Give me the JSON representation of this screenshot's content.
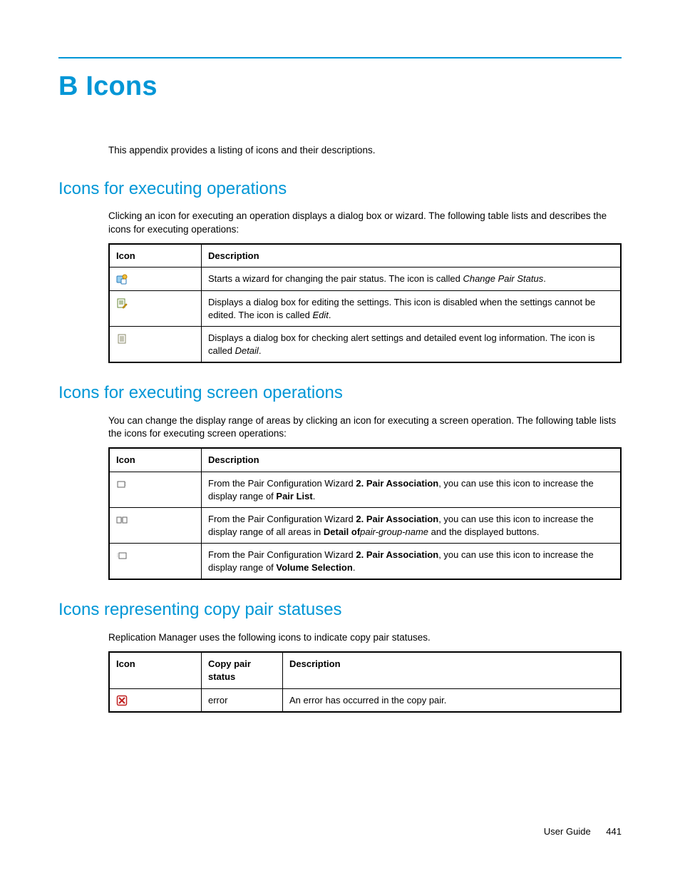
{
  "title": "B Icons",
  "intro": "This appendix provides a listing of icons and their descriptions.",
  "sec1": {
    "heading": "Icons for executing operations",
    "body": "Clicking an icon for executing an operation displays a dialog box or wizard. The following table lists and describes the icons for executing operations:",
    "head_icon": "Icon",
    "head_desc": "Description",
    "row1_desc_a": "Starts a wizard for changing the pair status. The icon is called ",
    "row1_desc_em": "Change Pair Status",
    "row1_desc_b": ".",
    "row2_desc_a": "Displays a dialog box for editing the settings. This icon is disabled when the settings cannot be edited. The icon is called ",
    "row2_desc_em": "Edit",
    "row2_desc_b": ".",
    "row3_desc_a": "Displays a dialog box for checking alert settings and detailed event log information. The icon is called ",
    "row3_desc_em": "Detail",
    "row3_desc_b": "."
  },
  "sec2": {
    "heading": "Icons for executing screen operations",
    "body": "You can change the display range of areas by clicking an icon for executing a screen operation. The following table lists the icons for executing screen operations:",
    "head_icon": "Icon",
    "head_desc": "Description",
    "r1a": "From the Pair Configuration Wizard ",
    "r1b": "2. Pair Association",
    "r1c": ", you can use this icon to increase the display range of ",
    "r1d": "Pair List",
    "r1e": ".",
    "r2a": "From the Pair Configuration Wizard ",
    "r2b": "2. Pair Association",
    "r2c": ", you can use this icon to increase the display range of all areas in ",
    "r2d": "Detail of",
    "r2e": "pair-group-name",
    "r2f": " and the displayed buttons.",
    "r3a": "From the Pair Configuration Wizard ",
    "r3b": "2. Pair Association",
    "r3c": ", you can use this icon to increase the display range of ",
    "r3d": "Volume Selection",
    "r3e": "."
  },
  "sec3": {
    "heading": "Icons representing copy pair statuses",
    "body": "Replication Manager uses the following icons to indicate copy pair statuses.",
    "head_icon": "Icon",
    "head_status": "Copy pair status",
    "head_desc": "Description",
    "status1": "error",
    "desc1": "An error has occurred in the copy pair."
  },
  "footer": {
    "label": "User Guide",
    "page": "441"
  }
}
